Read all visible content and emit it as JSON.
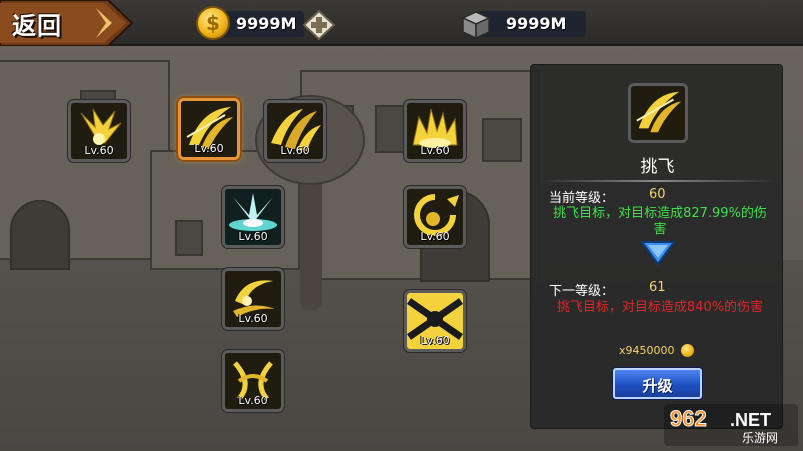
{
  "topbar": {
    "back_label": "返回",
    "gold_amount": "9999M",
    "gem_amount": "9999M"
  },
  "icons": {
    "gold": "gold-coin-icon",
    "add": "plus-icon",
    "gem": "cube-icon"
  },
  "skills": [
    {
      "level": "Lv.60",
      "icon": "burst-icon"
    },
    {
      "level": "Lv.60",
      "icon": "slash-icon",
      "selected": true
    },
    {
      "level": "Lv.60",
      "icon": "multi-slash-icon"
    },
    {
      "level": "Lv.60",
      "icon": "shockwave-icon"
    },
    {
      "level": "Lv.60",
      "icon": "crescent-slash-icon"
    },
    {
      "level": "Lv.60",
      "icon": "flame-burst-icon"
    },
    {
      "level": "Lv.60",
      "icon": "orbit-slash-icon"
    },
    {
      "level": "Lv.60",
      "icon": "cross-strike-icon"
    },
    {
      "level": "Lv.60",
      "icon": "whirlwind-icon"
    }
  ],
  "detail": {
    "name": "挑飞",
    "current_level_label": "当前等级：",
    "current_level": "60",
    "current_desc": "挑飞目标，对目标造成827.99%的伤害",
    "next_level_label": "下一等级：",
    "next_level": "61",
    "next_desc": "挑飞目标，对目标造成840%的伤害",
    "cost": "x9450000",
    "upgrade_label": "升级"
  },
  "colors": {
    "selected_border": "#e7943b",
    "current_desc": "#3fe04a",
    "next_desc": "#e0252a",
    "level_value": "#f3d36a",
    "upgrade_button": "#1f4fc0"
  },
  "watermark": {
    "brand": "962.NET",
    "subtitle": "乐游网"
  }
}
